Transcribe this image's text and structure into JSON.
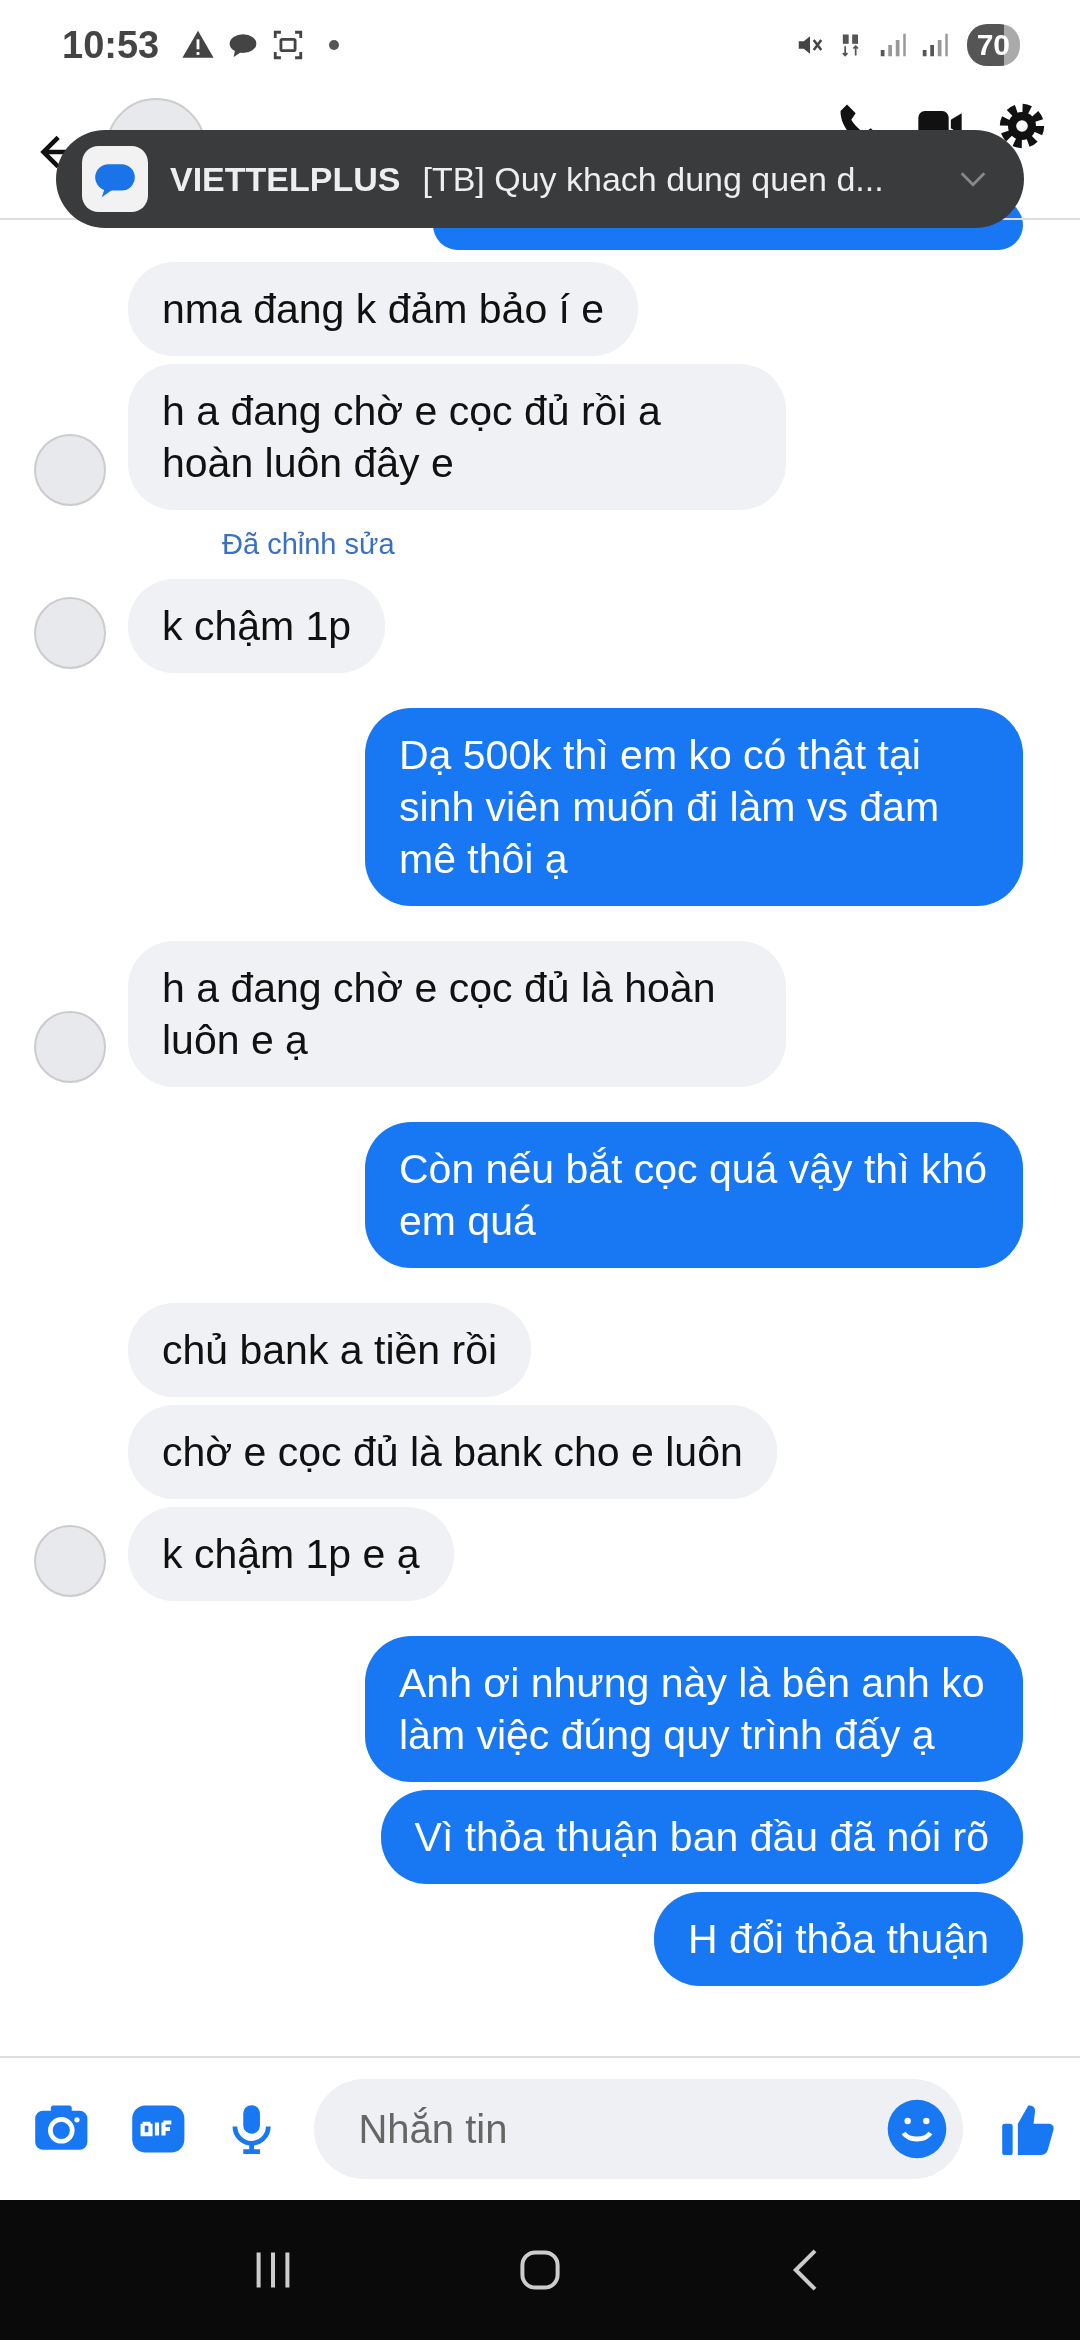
{
  "status_bar": {
    "time": "10:53",
    "battery": "70"
  },
  "notification": {
    "app": "VIETTELPLUS",
    "text": "[TB] Quy khach dung quen d..."
  },
  "messages": [
    {
      "kind": "received",
      "text": "nma đang k đảm bảo í e",
      "avatar": false
    },
    {
      "kind": "received",
      "text": "h a đang chờ e cọc đủ rồi a hoàn luôn đây e",
      "avatar": true
    },
    {
      "kind": "note",
      "text": "Đã chỉnh sửa"
    },
    {
      "kind": "received",
      "text": "k chậm 1p",
      "avatar": true
    },
    {
      "kind": "sent",
      "text": "Dạ 500k thì em ko có thật tại sinh viên muốn đi làm vs đam mê thôi ạ"
    },
    {
      "kind": "received",
      "text": "h a đang chờ e cọc đủ là hoàn luôn e ạ",
      "avatar": true
    },
    {
      "kind": "sent",
      "text": "Còn nếu bắt cọc quá vậy thì khó em quá"
    },
    {
      "kind": "received",
      "text": "chủ bank a tiền rồi",
      "avatar": false
    },
    {
      "kind": "received",
      "text": "chờ e cọc đủ là bank cho e luôn",
      "avatar": false
    },
    {
      "kind": "received",
      "text": "k chậm 1p e ạ",
      "avatar": true
    },
    {
      "kind": "sent",
      "text": "Anh ơi nhưng này là bên anh ko làm việc đúng quy trình đấy ạ"
    },
    {
      "kind": "sent",
      "text": "Vì thỏa thuận ban đầu đã nói rõ"
    },
    {
      "kind": "sent",
      "text": "H đổi thỏa thuận"
    }
  ],
  "composer": {
    "placeholder": "Nhắn tin"
  }
}
